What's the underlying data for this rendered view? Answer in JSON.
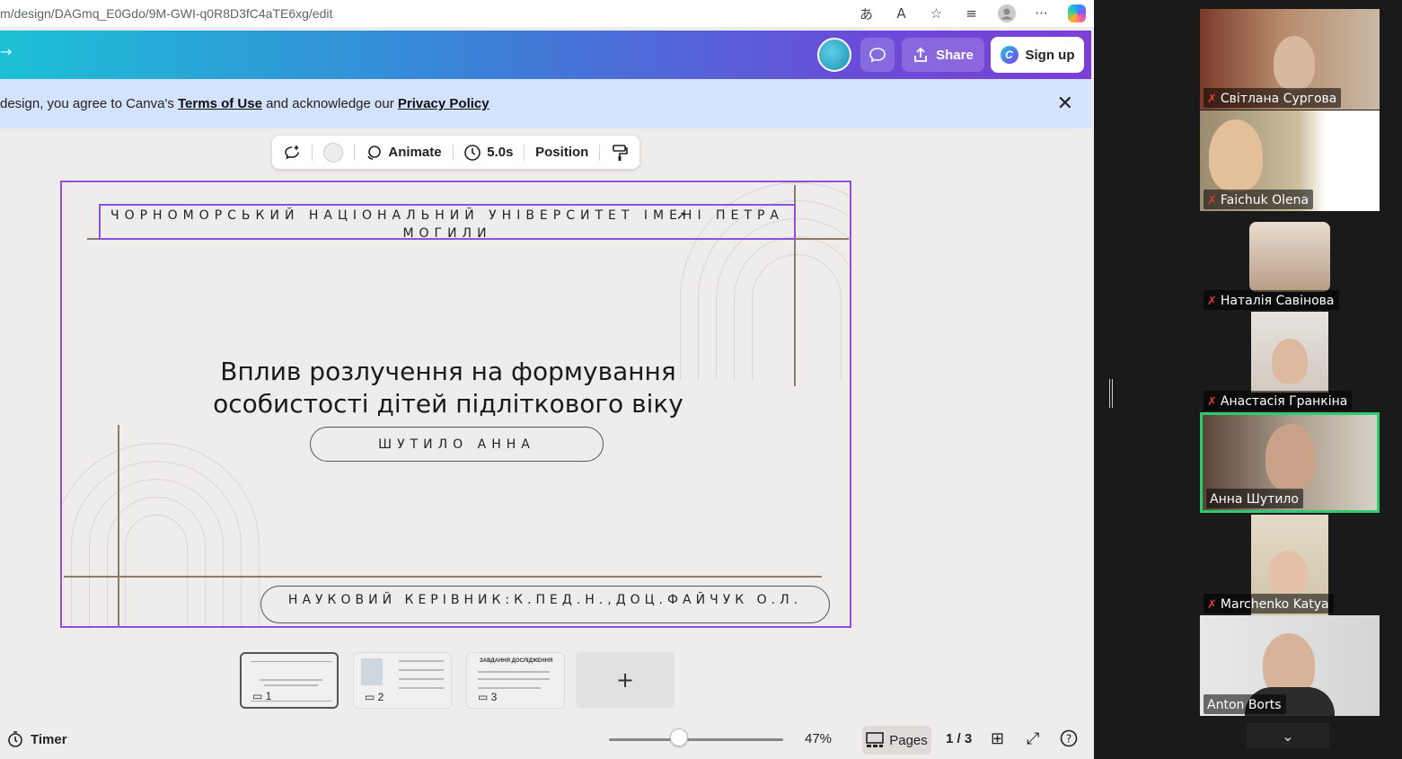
{
  "browser": {
    "url": "m/design/DAGmq_E0Gdo/9M-GWI-q0R8D3fC4aTE6xg/edit",
    "icons": [
      "translate-icon",
      "read-aloud-icon",
      "favorite-star-icon",
      "favorites-icon",
      "profile-icon",
      "more-icon",
      "copilot-icon"
    ]
  },
  "canva_header": {
    "share_label": "Share",
    "signup_label": "Sign up"
  },
  "terms_banner": {
    "text_before": "design, you agree to Canva's ",
    "terms_link": "Terms of Use",
    "text_middle": " and acknowledge our ",
    "privacy_link": "Privacy Policy"
  },
  "toolbar": {
    "animate_label": "Animate",
    "duration_label": "5.0s",
    "position_label": "Position"
  },
  "slide": {
    "university": "ЧОРНОМОРСЬКИЙ НАЦІОНАЛЬНИЙ УНІВЕРСИТЕТ ІМЕНІ ПЕТРА МОГИЛИ",
    "title_line1": "Вплив розлучення на формування",
    "title_line2": "особистості дітей підліткового віку",
    "author": "ШУТИЛО АННА",
    "supervisor": "НАУКОВИЙ КЕРІВНИК:К.ПЕД.Н.,ДОЦ.ФАЙЧУК О.Л."
  },
  "thumbnails": [
    {
      "num": "1",
      "caption": ""
    },
    {
      "num": "2",
      "caption": ""
    },
    {
      "num": "3",
      "caption": "ЗАВДАННЯ ДОСЛІДЖЕННЯ"
    }
  ],
  "bottom_bar": {
    "timer_label": "Timer",
    "zoom": "47%",
    "zoom_fraction": 0.4,
    "pages_label": "Pages",
    "page_count": "1 / 3"
  },
  "participants": [
    {
      "name": "Світлана Сургова",
      "muted": true
    },
    {
      "name": "Faichuk Olena",
      "muted": true
    },
    {
      "name": "Наталія Савінова",
      "muted": true
    },
    {
      "name": "Анастасія Гранкіна",
      "muted": true
    },
    {
      "name": "Анна Шутило",
      "muted": false,
      "active": true
    },
    {
      "name": "Marchenko Katya",
      "muted": true
    },
    {
      "name": "Anton Borts",
      "muted": false
    }
  ],
  "colors": {
    "canva_gradient_start": "#1cc0d6",
    "canva_gradient_end": "#7d3fd6",
    "selection_purple": "#8f4fe0",
    "active_speaker_green": "#2ecc71",
    "mic_muted_red": "#e03a3a"
  }
}
